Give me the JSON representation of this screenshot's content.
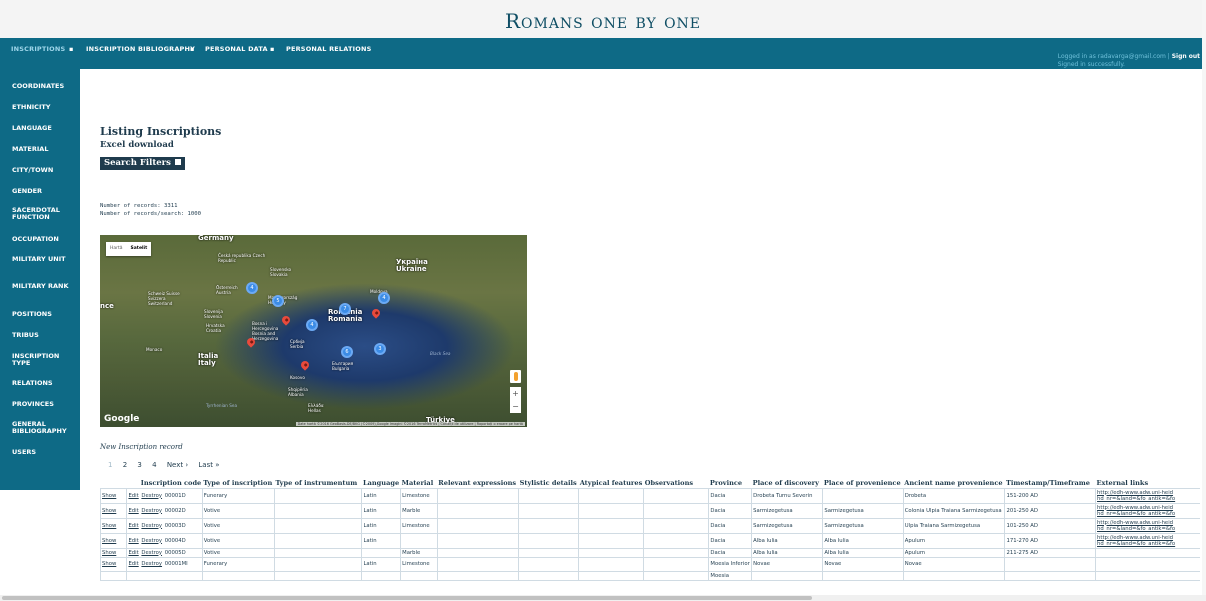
{
  "site": {
    "title": "Romans one by one"
  },
  "nav": {
    "items": [
      {
        "label": "INSCRIPTIONS",
        "name": "nav-inscriptions"
      },
      {
        "label": "INSCRIPTION BIBLIOGRAPHY",
        "name": "nav-inscription-bibliography"
      },
      {
        "label": "PERSONAL DATA",
        "name": "nav-personal-data"
      },
      {
        "label": "PERSONAL RELATIONS",
        "name": "nav-personal-relations"
      }
    ],
    "separator": "▪",
    "login_text": "Logged in as radavarga@gmail.com |",
    "sign_out": "Sign out",
    "signed_in": "Signed in successfully."
  },
  "sidebar": {
    "items": [
      {
        "label": "COORDINATES"
      },
      {
        "label": "ETHNICITY"
      },
      {
        "label": "LANGUAGE"
      },
      {
        "label": "MATERIAL"
      },
      {
        "label": "CITY/TOWN"
      },
      {
        "label": "GENDER"
      },
      {
        "label": "SACERDOTAL FUNCTION"
      },
      {
        "label": "OCCUPATION"
      },
      {
        "label": "MILITARY UNIT"
      },
      {
        "label": "MILITARY RANK"
      },
      {
        "label": "POSITIONS"
      },
      {
        "label": "TRIBUS"
      },
      {
        "label": "INSCRIPTION TYPE"
      },
      {
        "label": "RELATIONS"
      },
      {
        "label": "PROVINCES"
      },
      {
        "label": "GENERAL BIBLIOGRAPHY"
      },
      {
        "label": "USERS"
      }
    ]
  },
  "main": {
    "title": "Listing Inscriptions",
    "excel_link": "Excel download",
    "search_filters": "Search Filters",
    "records_total": "Number of records: 3311",
    "records_search": "Number of records/search: 1000",
    "new_record": "New Inscription record"
  },
  "map": {
    "toggle": {
      "map": "Hartă",
      "satellite": "Satelit"
    },
    "labels": [
      {
        "text": "Germany"
      },
      {
        "text": "Česká republika Czech Republic"
      },
      {
        "text": "Slovensko Slovakia"
      },
      {
        "text": "Österreich Austria"
      },
      {
        "text": "Magyarország Hungary"
      },
      {
        "text": "Україна Ukraine"
      },
      {
        "text": "Moldova"
      },
      {
        "text": "Schweiz Suisse Svizzera Switzerland"
      },
      {
        "text": "Slovenija Slovenia"
      },
      {
        "text": "Hrvatska Croatia"
      },
      {
        "text": "Bosna i Hercegovina Bosnia and Herzegovina"
      },
      {
        "text": "Србија Serbia"
      },
      {
        "text": "România Romania"
      },
      {
        "text": "Italia Italy"
      },
      {
        "text": "Monaco"
      },
      {
        "text": "България Bulgaria"
      },
      {
        "text": "Black Sea"
      },
      {
        "text": "Shqipëria Albania"
      },
      {
        "text": "Ελλάδα Hellas"
      },
      {
        "text": "Türkiye"
      },
      {
        "text": "Tyrrhenian Sea"
      },
      {
        "text": "Kosovo"
      },
      {
        "text": "nce"
      }
    ],
    "cluster_labels": [
      "4",
      "5",
      "7",
      "4",
      "3",
      "6",
      "4"
    ],
    "google": "Google",
    "attribution": "Date hartă ©2016 GeoBasis-DE/BKG (©2009),Google Imagini ©2016 TerraMetrics | Condiții de utilizare | Raportați o eroare pe hartă",
    "zoom_in": "+",
    "zoom_out": "−"
  },
  "pager": {
    "pages": [
      "1",
      "2",
      "3",
      "4"
    ],
    "next": "Next ›",
    "last": "Last »"
  },
  "table": {
    "actions": {
      "show": "Show",
      "edit": "Edit",
      "destroy": "Destroy"
    },
    "headers": [
      "",
      "Inscription code",
      "Type of inscription",
      "Type of instrumentum",
      "Language",
      "Material",
      "Relevant expressions",
      "Stylistic details",
      "Atypical features",
      "Observations",
      "Province",
      "Place of discovery",
      "Place of provenience",
      "Ancient name provenience",
      "Timestamp/Timeframe",
      "External links"
    ],
    "rows": [
      {
        "code": "00001D",
        "type": "Funerary",
        "instrumentum": "",
        "language": "Latin",
        "material": "Limestone",
        "province": "Dacia",
        "discovery": "Drobeta Turnu Severin",
        "provenience": "",
        "ancient": "Drobeta",
        "time": "151-200 AD",
        "link": "http://edh-www.adw.uni-heid hd_nr=&land=&fo_antik=&fo"
      },
      {
        "code": "00002D",
        "type": "Votive",
        "instrumentum": "",
        "language": "Latin",
        "material": "Marble",
        "province": "Dacia",
        "discovery": "Sarmizegetusa",
        "provenience": "Sarmizegetusa",
        "ancient": "Colonia Ulpia Traiana Sarmizegetusa",
        "time": "201-250 AD",
        "link": "http://edh-www.adw.uni-heid hd_nr=&land=&fo_antik=&fo"
      },
      {
        "code": "00003D",
        "type": "Votive",
        "instrumentum": "",
        "language": "Latin",
        "material": "Limestone",
        "province": "Dacia",
        "discovery": "Sarmizegetusa",
        "provenience": "Sarmizegetusa",
        "ancient": "Ulpia Traiana Sarmizegetusa",
        "time": "101-250 AD",
        "link": "http://edh-www.adw.uni-heid hd_nr=&land=&fo_antik=&fo"
      },
      {
        "code": "00004D",
        "type": "Votive",
        "instrumentum": "",
        "language": "Latin",
        "material": "",
        "province": "Dacia",
        "discovery": "Alba Iulia",
        "provenience": "Alba Iulia",
        "ancient": "Apulum",
        "time": "171-270 AD",
        "link": "http://edh-www.adw.uni-heid hd_nr=&land=&fo_antik=&fo"
      },
      {
        "code": "00005D",
        "type": "Votive",
        "instrumentum": "",
        "language": "",
        "material": "Marble",
        "province": "Dacia",
        "discovery": "Alba Iulia",
        "provenience": "Alba Iulia",
        "ancient": "Apulum",
        "time": "211-275 AD",
        "link": ""
      },
      {
        "code": "00001MI",
        "type": "Funerary",
        "instrumentum": "",
        "language": "Latin",
        "material": "Limestone",
        "province": "Moesia Inferior",
        "discovery": "Novae",
        "provenience": "Novae",
        "ancient": "Novae",
        "time": "",
        "link": ""
      },
      {
        "code": "",
        "type": "",
        "instrumentum": "",
        "language": "",
        "material": "",
        "province": "Moesia",
        "discovery": "",
        "provenience": "",
        "ancient": "",
        "time": "",
        "link": ""
      }
    ]
  }
}
